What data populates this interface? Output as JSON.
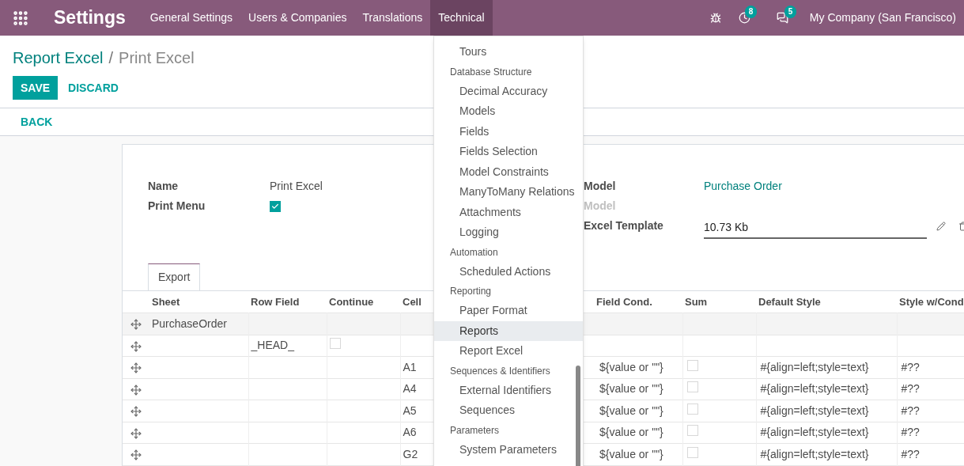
{
  "app_title": "Settings",
  "menus": [
    {
      "label": "General Settings",
      "selected": false
    },
    {
      "label": "Users & Companies",
      "selected": false
    },
    {
      "label": "Translations",
      "selected": false
    },
    {
      "label": "Technical",
      "selected": true
    }
  ],
  "activity_count": "8",
  "message_count": "5",
  "company": "My Company (San Francisco)",
  "breadcrumb": {
    "parent": "Report Excel",
    "separator": "/",
    "current": "Print Excel"
  },
  "buttons": {
    "save": "SAVE",
    "discard": "DISCARD",
    "back": "BACK"
  },
  "form": {
    "left": [
      {
        "label": "Name",
        "kind": "text",
        "value": "Print Excel"
      },
      {
        "label": "Print Menu",
        "kind": "checkbox",
        "checked": true
      }
    ],
    "right": [
      {
        "label": "Model",
        "kind": "link",
        "value": "Purchase Order",
        "muted": false
      },
      {
        "label": "Model",
        "kind": "empty",
        "muted": true
      },
      {
        "label": "Excel Template",
        "kind": "input",
        "value": "10.73 Kb",
        "muted": false
      }
    ]
  },
  "tabs": [
    {
      "label": "Export",
      "selected": true
    }
  ],
  "table": {
    "columns": [
      "Sheet",
      "Row Field",
      "Continue",
      "Cell",
      "Field Cond.",
      "Sum",
      "Default Style",
      "Style w/Cond"
    ],
    "rows": [
      {
        "sheet": "PurchaseOrder",
        "row_field": "",
        "cell": "",
        "field_cond": "",
        "default_style": "",
        "style_cond": ""
      },
      {
        "sheet": "",
        "row_field": "_HEAD_",
        "continue_checked": false,
        "cell": "",
        "field_cond": "",
        "default_style": "",
        "style_cond": ""
      },
      {
        "sheet": "",
        "row_field": "",
        "cell": "A1",
        "field_cond": "${value or \"\"}",
        "sum_checked": false,
        "default_style": "#{align=left;style=text}",
        "style_cond": "#??"
      },
      {
        "sheet": "",
        "row_field": "",
        "cell": "A4",
        "field_cond": "${value or \"\"}",
        "sum_checked": false,
        "default_style": "#{align=left;style=text}",
        "style_cond": "#??"
      },
      {
        "sheet": "",
        "row_field": "",
        "cell": "A5",
        "field_cond": "${value or \"\"}",
        "sum_checked": false,
        "default_style": "#{align=left;style=text}",
        "style_cond": "#??"
      },
      {
        "sheet": "",
        "row_field": "",
        "cell": "A6",
        "field_cond": "${value or \"\"}",
        "sum_checked": false,
        "default_style": "#{align=left;style=text}",
        "style_cond": "#??"
      },
      {
        "sheet": "",
        "row_field": "",
        "cell": "G2",
        "field_cond": "${value or \"\"}",
        "sum_checked": false,
        "default_style": "#{align=left;style=text}",
        "style_cond": "#??"
      }
    ]
  },
  "dropdown": [
    {
      "kind": "item",
      "label": "Tours",
      "selected": false
    },
    {
      "kind": "header",
      "label": "Database Structure"
    },
    {
      "kind": "item",
      "label": "Decimal Accuracy",
      "selected": false
    },
    {
      "kind": "item",
      "label": "Models",
      "selected": false
    },
    {
      "kind": "item",
      "label": "Fields",
      "selected": false
    },
    {
      "kind": "item",
      "label": "Fields Selection",
      "selected": false
    },
    {
      "kind": "item",
      "label": "Model Constraints",
      "selected": false
    },
    {
      "kind": "item",
      "label": "ManyToMany Relations",
      "selected": false
    },
    {
      "kind": "item",
      "label": "Attachments",
      "selected": false
    },
    {
      "kind": "item",
      "label": "Logging",
      "selected": false
    },
    {
      "kind": "header",
      "label": "Automation"
    },
    {
      "kind": "item",
      "label": "Scheduled Actions",
      "selected": false
    },
    {
      "kind": "header",
      "label": "Reporting"
    },
    {
      "kind": "item",
      "label": "Paper Format",
      "selected": false
    },
    {
      "kind": "item",
      "label": "Reports",
      "selected": true
    },
    {
      "kind": "item",
      "label": "Report Excel",
      "selected": false
    },
    {
      "kind": "header",
      "label": "Sequences & Identifiers"
    },
    {
      "kind": "item",
      "label": "External Identifiers",
      "selected": false
    },
    {
      "kind": "item",
      "label": "Sequences",
      "selected": false
    },
    {
      "kind": "header",
      "label": "Parameters"
    },
    {
      "kind": "item",
      "label": "System Parameters",
      "selected": false
    }
  ]
}
